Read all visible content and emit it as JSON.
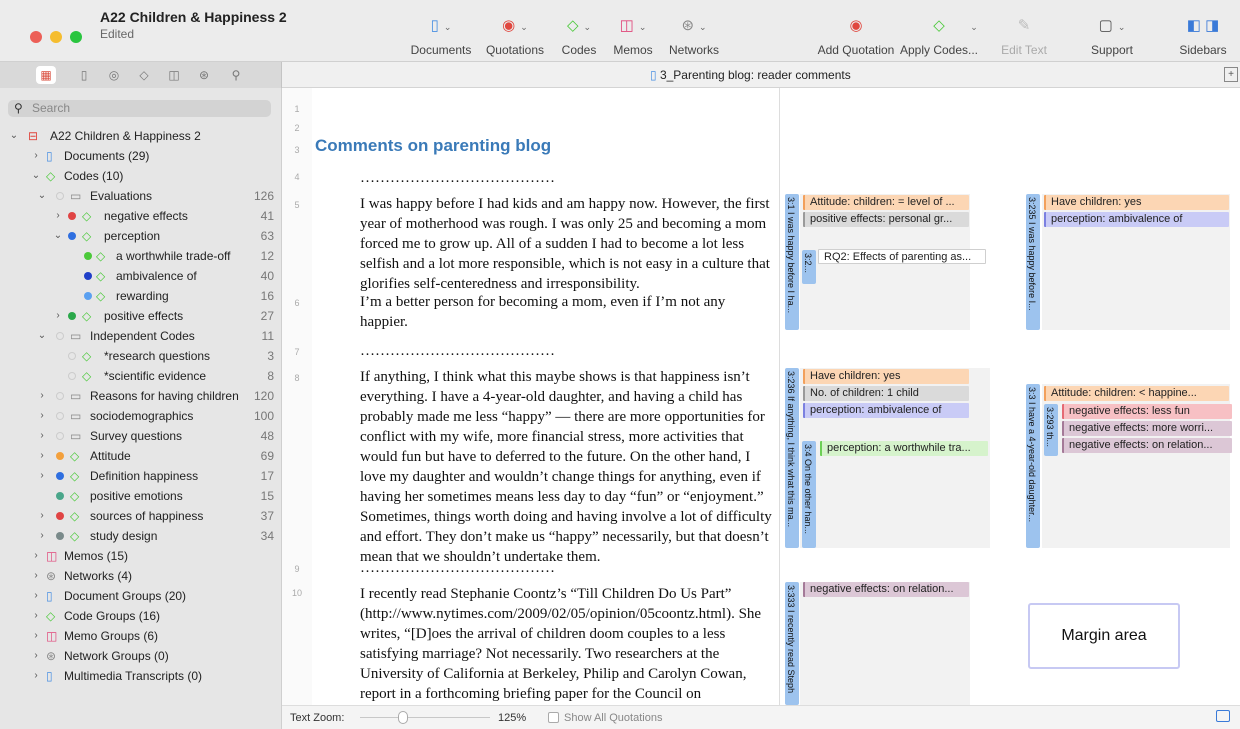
{
  "window": {
    "title": "A22 Children & Happiness 2",
    "subtitle": "Edited"
  },
  "toolbar": {
    "documents": "Documents",
    "quotations": "Quotations",
    "codes": "Codes",
    "memos": "Memos",
    "networks": "Networks",
    "add_quotation": "Add Quotation",
    "apply_codes": "Apply Codes...",
    "edit_text": "Edit Text",
    "support": "Support",
    "sidebars": "Sidebars"
  },
  "doc_tab": "3_Parenting blog: reader comments",
  "sidebar": {
    "search_placeholder": "Search",
    "items": [
      {
        "label": "A22 Children & Happiness 2",
        "count": ""
      },
      {
        "label": "Documents (29)",
        "count": ""
      },
      {
        "label": "Codes (10)",
        "count": ""
      },
      {
        "label": "Evaluations",
        "count": "126"
      },
      {
        "label": "negative effects",
        "count": "41"
      },
      {
        "label": "perception",
        "count": "63"
      },
      {
        "label": "a worthwhile trade-off",
        "count": "12"
      },
      {
        "label": "ambivalence of",
        "count": "40"
      },
      {
        "label": "rewarding",
        "count": "16"
      },
      {
        "label": "positive effects",
        "count": "27"
      },
      {
        "label": "Independent Codes",
        "count": "11"
      },
      {
        "label": "*research questions",
        "count": "3"
      },
      {
        "label": "*scientific evidence",
        "count": "8"
      },
      {
        "label": "Reasons for having children",
        "count": "120"
      },
      {
        "label": "sociodemographics",
        "count": "100"
      },
      {
        "label": "Survey questions",
        "count": "48"
      },
      {
        "label": "Attitude",
        "count": "69"
      },
      {
        "label": "Definition happiness",
        "count": "17"
      },
      {
        "label": "positive emotions",
        "count": "15"
      },
      {
        "label": "sources of happiness",
        "count": "37"
      },
      {
        "label": "study design",
        "count": "34"
      },
      {
        "label": "Memos (15)",
        "count": ""
      },
      {
        "label": "Networks (4)",
        "count": ""
      },
      {
        "label": "Document Groups (20)",
        "count": ""
      },
      {
        "label": "Code Groups (16)",
        "count": ""
      },
      {
        "label": "Memo Groups (6)",
        "count": ""
      },
      {
        "label": "Network Groups (0)",
        "count": ""
      },
      {
        "label": "Multimedia Transcripts (0)",
        "count": ""
      }
    ]
  },
  "document": {
    "line_numbers": [
      "1",
      "2",
      "3",
      "4",
      "5",
      "6",
      "7",
      "8",
      "9",
      "10"
    ],
    "heading": "Comments on parenting blog",
    "separator": "…………………………………",
    "p1": "I was happy before I had kids and am happy now. However, the first year of motherhood was rough. I was only 25 and becoming a mom forced me to grow up. All of a sudden I had to become a lot less selfish and a lot more responsible, which is not easy in a culture that glorifies self-centeredness and irresponsibility.",
    "p2": "I’m a better person for becoming a mom, even if I’m not any happier.",
    "p3": "If anything, I think what this maybe shows is that happiness isn’t everything. I have a 4-year-old daughter, and having a child has probably made me less “happy” — there are more opportunities for conflict with my wife, more financial stress, more activities that would fun but have to deferred to the future. On the other hand, I love my daughter and wouldn’t change things for anything, even if having her sometimes means less day to day “fun” or “enjoyment.” Sometimes, things worth doing and having involve a lot of difficulty and effort. They don’t make us “happy” necessarily, but that doesn’t mean that we shouldn’t undertake them.",
    "p4": "I recently read Stephanie Coontz’s “Till Children Do Us Part” (http://www.nytimes.com/2009/02/05/opinion/05coontz.html). She writes, “[D]oes the arrival of children doom couples to a less satisfying marriage? Not necessarily. Two researchers at the University of California at Berkeley, Philip and Carolyn Cowan, report in a forthcoming briefing paper for the Council on Contemporary Families that most studies finding a large drop in"
  },
  "margin": {
    "quotes": [
      "3:1 I was happy before I ha...",
      "3:2...",
      "3:235 I was happy before I...",
      "3:236 If anything, I think what this ma...",
      "3:4 On the other han...",
      "3:3 I have a 4-year-old daughter...",
      "3:293 th...",
      "3:333 I recently read Steph"
    ],
    "tags": [
      "Attitude: children: = level of ...",
      "positive effects: personal gr...",
      "RQ2: Effects of parenting as...",
      "Have children: yes",
      "perception: ambivalence of",
      "Have children: yes",
      "No. of children: 1 child",
      "perception: ambivalence of",
      "perception: a worthwhile tra...",
      "Attitude: children: < happine...",
      "negative effects: less fun",
      "negative effects: more worri...",
      "negative effects: on relation...",
      "negative effects: on relation..."
    ],
    "margin_label": "Margin area"
  },
  "status": {
    "zoom_label": "Text Zoom:",
    "zoom_value": "125%",
    "show_all": "Show All Quotations"
  },
  "colors": {
    "code_green": "#4bc93a",
    "code_blue": "#2f6fe0",
    "code_red": "#e04444",
    "code_orange": "#f3a03c",
    "code_teal": "#4aa68a",
    "code_gray": "#7a8a8a",
    "quote_bar": "#9dc3ee"
  }
}
